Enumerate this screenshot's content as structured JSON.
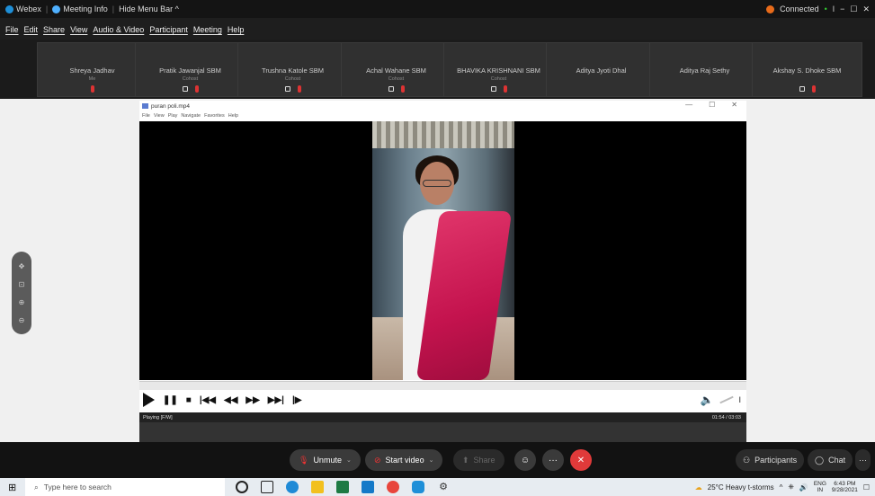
{
  "topbar": {
    "app": "Webex",
    "meeting_info": "Meeting Info",
    "hide_menu": "Hide Menu Bar ^",
    "connected": "Connected",
    "colors": {
      "connected": "#e86b1a",
      "webex": "#1e8fd8"
    }
  },
  "menu": [
    "File",
    "Edit",
    "Share",
    "View",
    "Audio & Video",
    "Participant",
    "Meeting",
    "Help"
  ],
  "participants": [
    {
      "name": "Shreya Jadhav",
      "role": "Me"
    },
    {
      "name": "Pratik Jawanjal SBM",
      "role": "Cohost"
    },
    {
      "name": "Trushna Katole SBM",
      "role": "Cohost"
    },
    {
      "name": "Achal Wahane SBM",
      "role": "Cohost"
    },
    {
      "name": "BHAVIKA KRISHNANI SBM",
      "role": "Cohost"
    },
    {
      "name": "Aditya Jyoti Dhal",
      "role": ""
    },
    {
      "name": "Aditya Raj Sethy",
      "role": ""
    },
    {
      "name": "Akshay S. Dhoke SBM",
      "role": ""
    }
  ],
  "player": {
    "title": "puran poli.mp4",
    "menu": [
      "File",
      "View",
      "Play",
      "Navigate",
      "Favorites",
      "Help"
    ],
    "status_left": "Playing [F/W]",
    "status_right": "01:54 / 03:03"
  },
  "bottom": {
    "unmute": "Unmute",
    "start_video": "Start video",
    "share": "Share",
    "participants": "Participants",
    "chat": "Chat"
  },
  "taskbar": {
    "search_placeholder": "Type here to search",
    "weather": "25°C  Heavy t-storms",
    "lang": "ENG",
    "region": "IN",
    "time": "6:43 PM",
    "date": "9/28/2021"
  }
}
